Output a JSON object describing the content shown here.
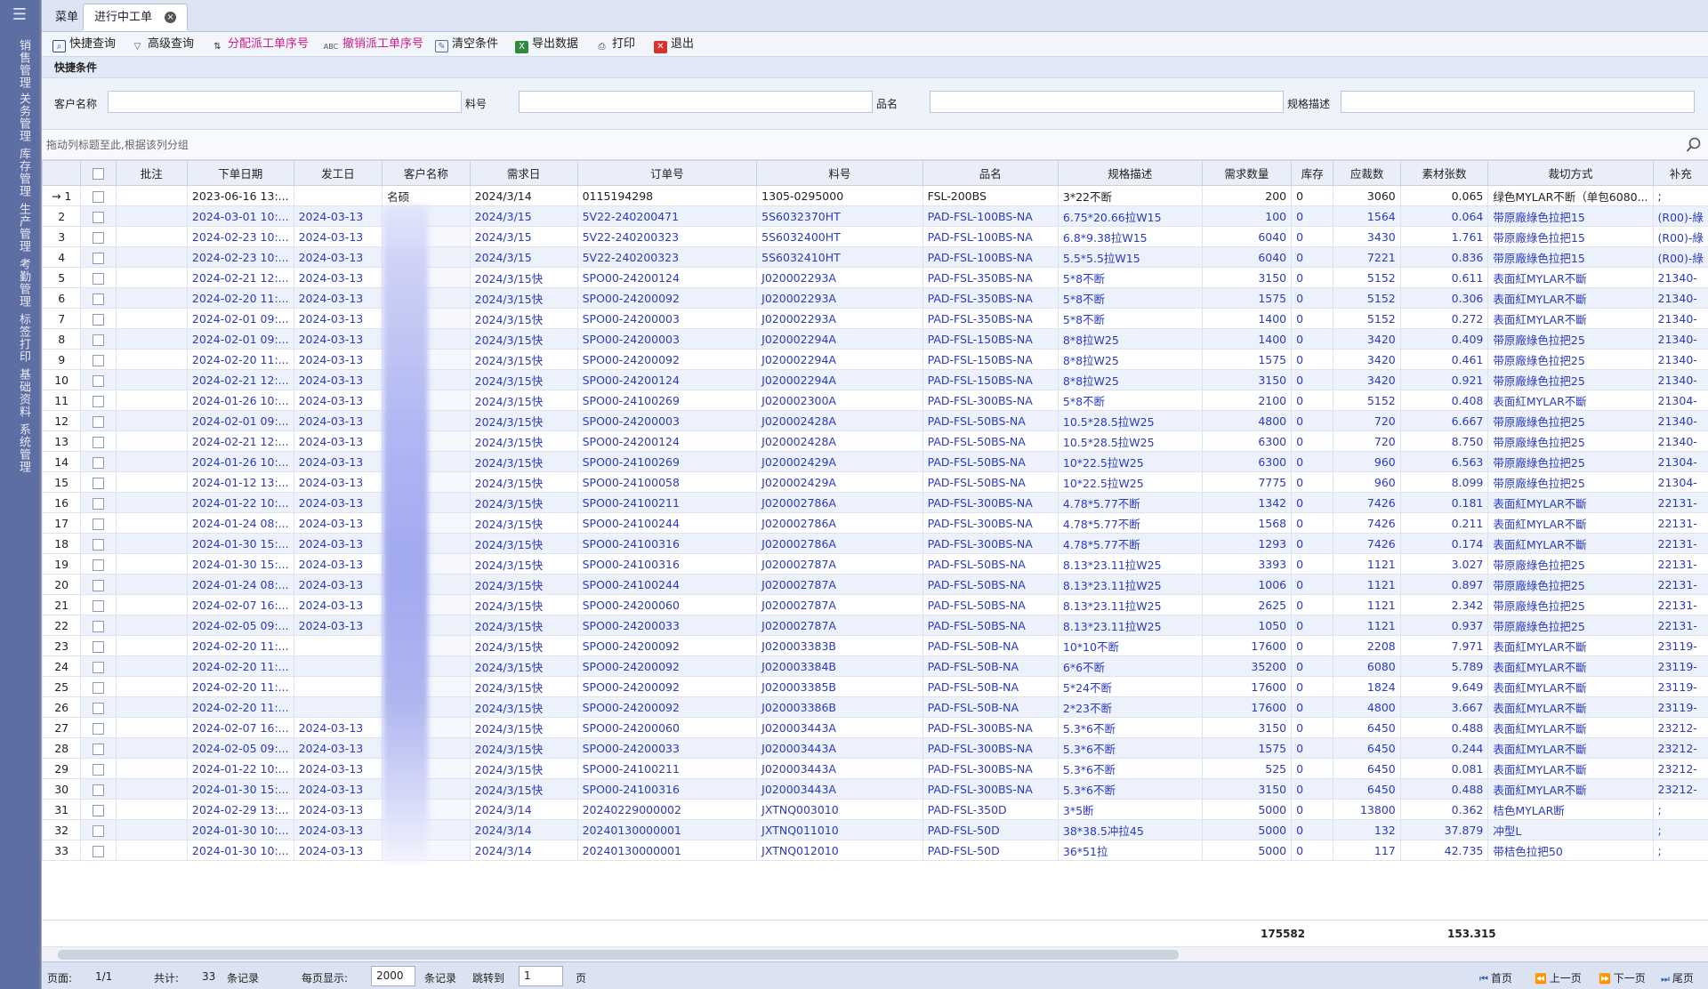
{
  "sidebar": {
    "menu_icon": "menu-icon",
    "items": [
      "销售管理",
      "关务管理",
      "库存管理",
      "生产管理",
      "考勤管理",
      "标签打印",
      "基础资料",
      "系统管理"
    ]
  },
  "tabs": [
    {
      "label": "菜单"
    },
    {
      "label": "进行中工单",
      "close": "×"
    }
  ],
  "toolbar": [
    {
      "label": "快捷查询",
      "icon": "magnifier-icon"
    },
    {
      "label": "高级查询",
      "icon": "filter-icon"
    },
    {
      "label": "分配派工单序号",
      "icon": "sort-icon"
    },
    {
      "label": "撤销派工单序号",
      "icon": "abc-icon"
    },
    {
      "label": "清空条件",
      "icon": "clear-icon"
    },
    {
      "label": "导出数据",
      "icon": "excel-icon"
    },
    {
      "label": "打印",
      "icon": "printer-icon"
    },
    {
      "label": "退出",
      "icon": "exit-icon"
    }
  ],
  "quick": {
    "title": "快捷条件",
    "customer_label": "客户名称",
    "part_label": "料号",
    "product_label": "品名",
    "spec_label": "规格描述"
  },
  "group_hint": "拖动列标题至此,根据该列分组",
  "columns": [
    "",
    "批注",
    "下单日期",
    "发工日",
    "客户名称",
    "需求日",
    "订单号",
    "料号",
    "品名",
    "规格描述",
    "需求数量",
    "库存",
    "应裁数",
    "素材张数",
    "裁切方式",
    "补充"
  ],
  "rows": [
    [
      "1",
      "",
      "2023-06-16 13:...",
      "",
      "名硕",
      "2024/3/14",
      "0115194298",
      "1305-0295000",
      "FSL-200BS",
      "3*22不断",
      "200",
      "0",
      "3060",
      "0.065",
      "绿色MYLAR不断（单包6080...",
      ";"
    ],
    [
      "2",
      "",
      "2024-03-01 10:...",
      "2024-03-13",
      "",
      "2024/3/15",
      "5V22-240200471",
      "5S6032370HT",
      "PAD-FSL-100BS-NA",
      "6.75*20.66拉W15",
      "100",
      "0",
      "1564",
      "0.064",
      "带原廠綠色拉把15",
      "(R00)-綠"
    ],
    [
      "3",
      "",
      "2024-02-23 10:...",
      "2024-03-13",
      "",
      "2024/3/15",
      "5V22-240200323",
      "5S6032400HT",
      "PAD-FSL-100BS-NA",
      "6.8*9.38拉W15",
      "6040",
      "0",
      "3430",
      "1.761",
      "带原廠綠色拉把15",
      "(R00)-綠"
    ],
    [
      "4",
      "",
      "2024-02-23 10:...",
      "2024-03-13",
      "",
      "2024/3/15",
      "5V22-240200323",
      "5S6032410HT",
      "PAD-FSL-100BS-NA",
      "5.5*5.5拉W15",
      "6040",
      "0",
      "7221",
      "0.836",
      "带原廠綠色拉把15",
      "(R00)-綠"
    ],
    [
      "5",
      "",
      "2024-02-21 12:...",
      "2024-03-13",
      "",
      "2024/3/15快",
      "SPO00-24200124",
      "J020002293A",
      "PAD-FSL-350BS-NA",
      "5*8不断",
      "3150",
      "0",
      "5152",
      "0.611",
      "表面紅MYLAR不斷",
      "21340-"
    ],
    [
      "6",
      "",
      "2024-02-20 11:...",
      "2024-03-13",
      "",
      "2024/3/15快",
      "SPO00-24200092",
      "J020002293A",
      "PAD-FSL-350BS-NA",
      "5*8不断",
      "1575",
      "0",
      "5152",
      "0.306",
      "表面紅MYLAR不斷",
      "21340-"
    ],
    [
      "7",
      "",
      "2024-02-01 09:...",
      "2024-03-13",
      "",
      "2024/3/15快",
      "SPO00-24200003",
      "J020002293A",
      "PAD-FSL-350BS-NA",
      "5*8不断",
      "1400",
      "0",
      "5152",
      "0.272",
      "表面紅MYLAR不斷",
      "21340-"
    ],
    [
      "8",
      "",
      "2024-02-01 09:...",
      "2024-03-13",
      "",
      "2024/3/15快",
      "SPO00-24200003",
      "J020002294A",
      "PAD-FSL-150BS-NA",
      "8*8拉W25",
      "1400",
      "0",
      "3420",
      "0.409",
      "带原廠綠色拉把25",
      "21340-"
    ],
    [
      "9",
      "",
      "2024-02-20 11:...",
      "2024-03-13",
      "",
      "2024/3/15快",
      "SPO00-24200092",
      "J020002294A",
      "PAD-FSL-150BS-NA",
      "8*8拉W25",
      "1575",
      "0",
      "3420",
      "0.461",
      "带原廠綠色拉把25",
      "21340-"
    ],
    [
      "10",
      "",
      "2024-02-21 12:...",
      "2024-03-13",
      "",
      "2024/3/15快",
      "SPO00-24200124",
      "J020002294A",
      "PAD-FSL-150BS-NA",
      "8*8拉W25",
      "3150",
      "0",
      "3420",
      "0.921",
      "带原廠綠色拉把25",
      "21340-"
    ],
    [
      "11",
      "",
      "2024-01-26 10:...",
      "2024-03-13",
      "",
      "2024/3/15快",
      "SPO00-24100269",
      "J020002300A",
      "PAD-FSL-300BS-NA",
      "5*8不断",
      "2100",
      "0",
      "5152",
      "0.408",
      "表面紅MYLAR不斷",
      "21304-"
    ],
    [
      "12",
      "",
      "2024-02-01 09:...",
      "2024-03-13",
      "",
      "2024/3/15快",
      "SPO00-24200003",
      "J020002428A",
      "PAD-FSL-50BS-NA",
      "10.5*28.5拉W25",
      "4800",
      "0",
      "720",
      "6.667",
      "带原廠綠色拉把25",
      "21340-"
    ],
    [
      "13",
      "",
      "2024-02-21 12:...",
      "2024-03-13",
      "",
      "2024/3/15快",
      "SPO00-24200124",
      "J020002428A",
      "PAD-FSL-50BS-NA",
      "10.5*28.5拉W25",
      "6300",
      "0",
      "720",
      "8.750",
      "带原廠綠色拉把25",
      "21340-"
    ],
    [
      "14",
      "",
      "2024-01-26 10:...",
      "2024-03-13",
      "",
      "2024/3/15快",
      "SPO00-24100269",
      "J020002429A",
      "PAD-FSL-50BS-NA",
      "10*22.5拉W25",
      "6300",
      "0",
      "960",
      "6.563",
      "带原廠綠色拉把25",
      "21304-"
    ],
    [
      "15",
      "",
      "2024-01-12 13:...",
      "2024-03-13",
      "",
      "2024/3/15快",
      "SPO00-24100058",
      "J020002429A",
      "PAD-FSL-50BS-NA",
      "10*22.5拉W25",
      "7775",
      "0",
      "960",
      "8.099",
      "带原廠綠色拉把25",
      "21304-"
    ],
    [
      "16",
      "",
      "2024-01-22 10:...",
      "2024-03-13",
      "",
      "2024/3/15快",
      "SPO00-24100211",
      "J020002786A",
      "PAD-FSL-300BS-NA",
      "4.78*5.77不断",
      "1342",
      "0",
      "7426",
      "0.181",
      "表面紅MYLAR不斷",
      "22131-"
    ],
    [
      "17",
      "",
      "2024-01-24 08:...",
      "2024-03-13",
      "",
      "2024/3/15快",
      "SPO00-24100244",
      "J020002786A",
      "PAD-FSL-300BS-NA",
      "4.78*5.77不断",
      "1568",
      "0",
      "7426",
      "0.211",
      "表面紅MYLAR不斷",
      "22131-"
    ],
    [
      "18",
      "",
      "2024-01-30 15:...",
      "2024-03-13",
      "",
      "2024/3/15快",
      "SPO00-24100316",
      "J020002786A",
      "PAD-FSL-300BS-NA",
      "4.78*5.77不断",
      "1293",
      "0",
      "7426",
      "0.174",
      "表面紅MYLAR不斷",
      "22131-"
    ],
    [
      "19",
      "",
      "2024-01-30 15:...",
      "2024-03-13",
      "",
      "2024/3/15快",
      "SPO00-24100316",
      "J020002787A",
      "PAD-FSL-50BS-NA",
      "8.13*23.11拉W25",
      "3393",
      "0",
      "1121",
      "3.027",
      "带原廠綠色拉把25",
      "22131-"
    ],
    [
      "20",
      "",
      "2024-01-24 08:...",
      "2024-03-13",
      "",
      "2024/3/15快",
      "SPO00-24100244",
      "J020002787A",
      "PAD-FSL-50BS-NA",
      "8.13*23.11拉W25",
      "1006",
      "0",
      "1121",
      "0.897",
      "带原廠綠色拉把25",
      "22131-"
    ],
    [
      "21",
      "",
      "2024-02-07 16:...",
      "2024-03-13",
      "",
      "2024/3/15快",
      "SPO00-24200060",
      "J020002787A",
      "PAD-FSL-50BS-NA",
      "8.13*23.11拉W25",
      "2625",
      "0",
      "1121",
      "2.342",
      "带原廠綠色拉把25",
      "22131-"
    ],
    [
      "22",
      "",
      "2024-02-05 09:...",
      "2024-03-13",
      "",
      "2024/3/15快",
      "SPO00-24200033",
      "J020002787A",
      "PAD-FSL-50BS-NA",
      "8.13*23.11拉W25",
      "1050",
      "0",
      "1121",
      "0.937",
      "带原廠綠色拉把25",
      "22131-"
    ],
    [
      "23",
      "",
      "2024-02-20 11:...",
      "",
      "",
      "2024/3/15快",
      "SPO00-24200092",
      "J020003383B",
      "PAD-FSL-50B-NA",
      "10*10不断",
      "17600",
      "0",
      "2208",
      "7.971",
      "表面紅MYLAR不斷",
      "23119-"
    ],
    [
      "24",
      "",
      "2024-02-20 11:...",
      "",
      "",
      "2024/3/15快",
      "SPO00-24200092",
      "J020003384B",
      "PAD-FSL-50B-NA",
      "6*6不断",
      "35200",
      "0",
      "6080",
      "5.789",
      "表面紅MYLAR不斷",
      "23119-"
    ],
    [
      "25",
      "",
      "2024-02-20 11:...",
      "",
      "",
      "2024/3/15快",
      "SPO00-24200092",
      "J020003385B",
      "PAD-FSL-50B-NA",
      "5*24不断",
      "17600",
      "0",
      "1824",
      "9.649",
      "表面紅MYLAR不斷",
      "23119-"
    ],
    [
      "26",
      "",
      "2024-02-20 11:...",
      "",
      "",
      "2024/3/15快",
      "SPO00-24200092",
      "J020003386B",
      "PAD-FSL-50B-NA",
      "2*23不断",
      "17600",
      "0",
      "4800",
      "3.667",
      "表面紅MYLAR不斷",
      "23119-"
    ],
    [
      "27",
      "",
      "2024-02-07 16:...",
      "2024-03-13",
      "",
      "2024/3/15快",
      "SPO00-24200060",
      "J020003443A",
      "PAD-FSL-300BS-NA",
      "5.3*6不断",
      "3150",
      "0",
      "6450",
      "0.488",
      "表面紅MYLAR不斷",
      "23212-"
    ],
    [
      "28",
      "",
      "2024-02-05 09:...",
      "2024-03-13",
      "",
      "2024/3/15快",
      "SPO00-24200033",
      "J020003443A",
      "PAD-FSL-300BS-NA",
      "5.3*6不断",
      "1575",
      "0",
      "6450",
      "0.244",
      "表面紅MYLAR不斷",
      "23212-"
    ],
    [
      "29",
      "",
      "2024-01-22 10:...",
      "2024-03-13",
      "",
      "2024/3/15快",
      "SPO00-24100211",
      "J020003443A",
      "PAD-FSL-300BS-NA",
      "5.3*6不断",
      "525",
      "0",
      "6450",
      "0.081",
      "表面紅MYLAR不斷",
      "23212-"
    ],
    [
      "30",
      "",
      "2024-01-30 15:...",
      "2024-03-13",
      "",
      "2024/3/15快",
      "SPO00-24100316",
      "J020003443A",
      "PAD-FSL-300BS-NA",
      "5.3*6不断",
      "3150",
      "0",
      "6450",
      "0.488",
      "表面紅MYLAR不斷",
      "23212-"
    ],
    [
      "31",
      "",
      "2024-02-29 13:...",
      "2024-03-13",
      "",
      "2024/3/14",
      "20240229000002",
      "JXTNQ003010",
      "PAD-FSL-350D",
      "3*5断",
      "5000",
      "0",
      "13800",
      "0.362",
      "桔色MYLAR断",
      ";"
    ],
    [
      "32",
      "",
      "2024-01-30 10:...",
      "2024-03-13",
      "",
      "2024/3/14",
      "20240130000001",
      "JXTNQ011010",
      "PAD-FSL-50D",
      "38*38.5冲拉45",
      "5000",
      "0",
      "132",
      "37.879",
      "冲型L",
      ";"
    ],
    [
      "33",
      "",
      "2024-01-30 10:...",
      "2024-03-13",
      "",
      "2024/3/14",
      "20240130000001",
      "JXTNQ012010",
      "PAD-FSL-50D",
      "36*51拉",
      "5000",
      "0",
      "117",
      "42.735",
      "带桔色拉把50",
      ";"
    ]
  ],
  "summary": {
    "demand_total": "175582",
    "material_total": "153.315"
  },
  "pager": {
    "page_label": "页面:",
    "page_value": "1/1",
    "total_label": "共计:",
    "total_value": "33",
    "records_label": "条记录",
    "per_page_label": "每页显示:",
    "per_page_value": "2000",
    "records_label2": "条记录",
    "jump_label": "跳转到",
    "jump_value": "1",
    "page_unit": "页",
    "first": "首页",
    "prev": "上一页",
    "next": "下一页",
    "last": "尾页"
  }
}
